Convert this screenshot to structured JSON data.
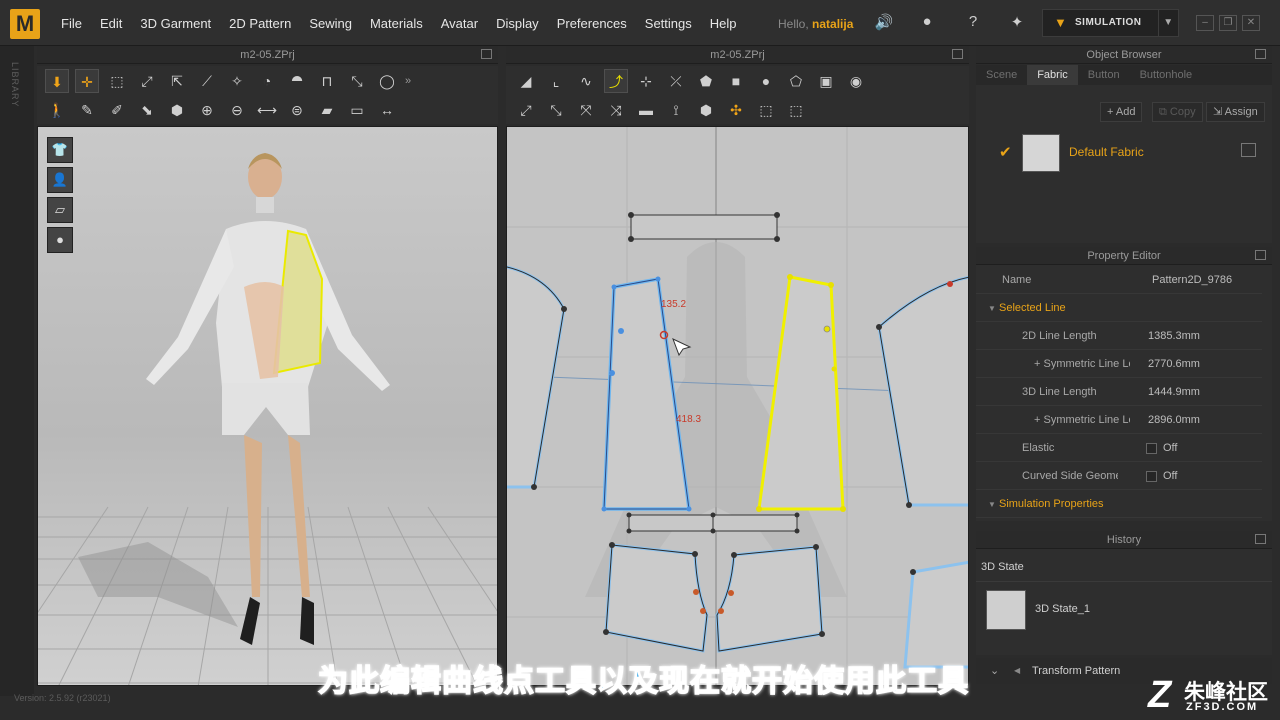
{
  "app": {
    "logo": "M",
    "hello": "Hello,",
    "user": "natalija"
  },
  "menu": [
    "File",
    "Edit",
    "3D Garment",
    "2D Pattern",
    "Sewing",
    "Materials",
    "Avatar",
    "Display",
    "Preferences",
    "Settings",
    "Help"
  ],
  "simulation_label": "SIMULATION",
  "library_label": "LIBRARY",
  "view3d": {
    "title": "m2-05.ZPrj"
  },
  "view2d": {
    "title": "m2-05.ZPrj",
    "measure_top": "135.2",
    "measure_side": "418.3"
  },
  "object_browser": {
    "title": "Object Browser",
    "tabs": [
      "Scene",
      "Fabric",
      "Button",
      "Buttonhole"
    ],
    "active_tab": "Fabric",
    "buttons": {
      "add": "Add",
      "copy": "Copy",
      "assign": "Assign"
    },
    "fabric_name": "Default Fabric"
  },
  "property_editor": {
    "title": "Property Editor",
    "name_label": "Name",
    "name_value": "Pattern2D_9786",
    "selected_line": "Selected Line",
    "line_2d_label": "2D Line Length",
    "line_2d_value": "1385.3mm",
    "sym_label_1": "+ Symmetric Line Le",
    "sym_value_1": "2770.6mm",
    "line_3d_label": "3D Line Length",
    "line_3d_value": "1444.9mm",
    "sym_label_2": "+ Symmetric Line Le",
    "sym_value_2": "2896.0mm",
    "elastic_label": "Elastic",
    "elastic_value": "Off",
    "curved_label": "Curved Side Geome",
    "curved_value": "Off",
    "simulation_properties": "Simulation Properties"
  },
  "history": {
    "title": "History",
    "state_label": "3D State",
    "item_label": "3D State_1",
    "transform_label": "Transform Pattern"
  },
  "status_version": "Version: 2.5.92   (r23021)",
  "subtitle": "为此编辑曲线点工具以及现在就开始使用此工具",
  "watermark": {
    "cn": "朱峰社区",
    "en": "ZF3D.COM"
  },
  "colors": {
    "accent": "#e8a318",
    "selected_pattern": "#e8e000",
    "pattern_outline": "#6fb0e8",
    "measure": "#c83a2a"
  }
}
